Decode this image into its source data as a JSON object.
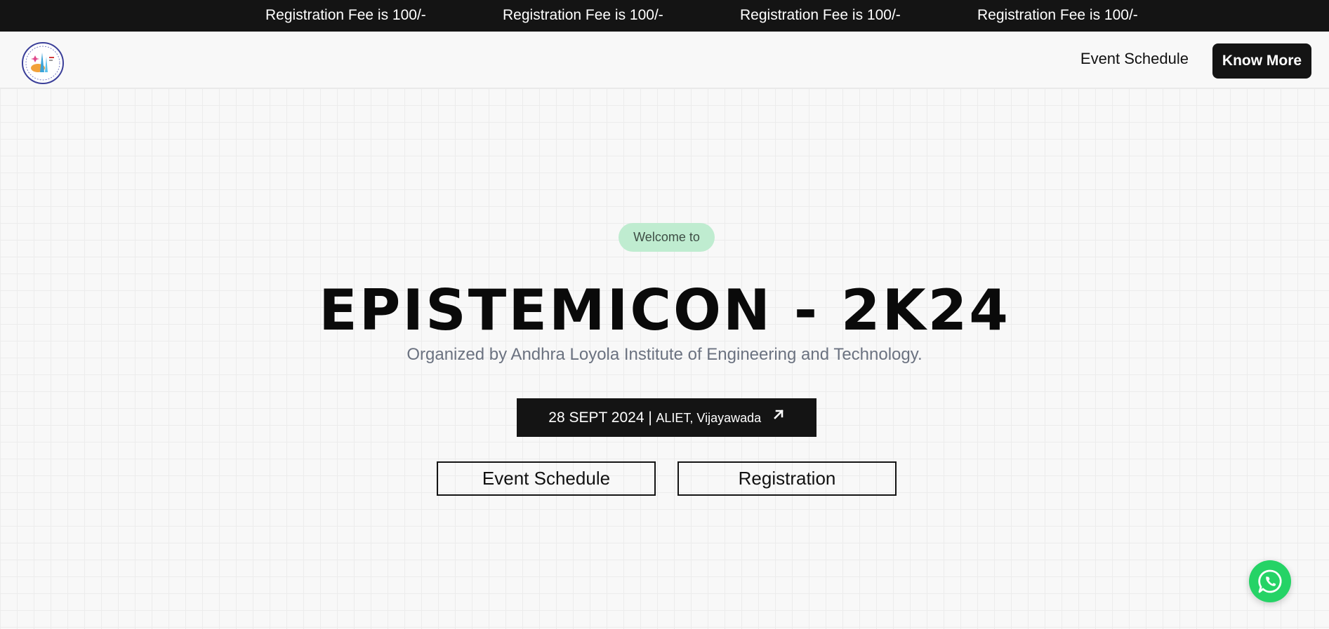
{
  "ticker": {
    "items": [
      "Registration Fee is 100/-",
      "Registration Fee is 100/-",
      "Registration Fee is 100/-",
      "Registration Fee is 100/-"
    ]
  },
  "header": {
    "logo_icon": "college-seal-icon",
    "nav": {
      "event_schedule": "Event Schedule",
      "know_more": "Know More"
    }
  },
  "hero": {
    "welcome": "Welcome to",
    "title": "EPISTEMICON - 2K24",
    "subtitle": "Organized by Andhra Loyola Institute of Engineering and Technology.",
    "date": "28 SEPT 2024 |",
    "venue": "ALIET, Vijayawada",
    "date_icon": "arrow-up-right-icon",
    "buttons": {
      "schedule": "Event Schedule",
      "registration": "Registration"
    }
  },
  "floating": {
    "whatsapp_icon": "whatsapp-icon"
  },
  "colors": {
    "dark": "#141414",
    "pill": "#bfecd0",
    "subtitle": "#6b7280",
    "whatsapp": "#25d366"
  }
}
